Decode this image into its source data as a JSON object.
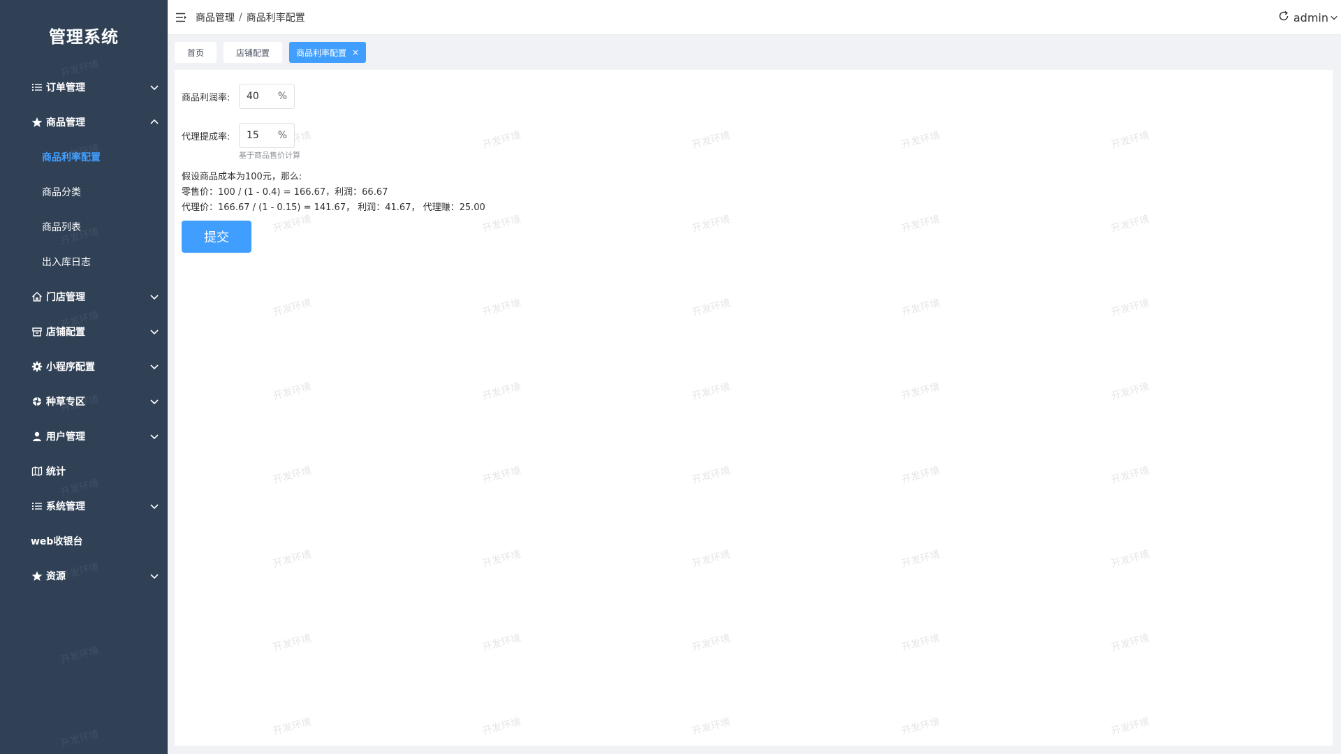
{
  "app": {
    "title": "管理系统"
  },
  "sidebar": {
    "items": [
      {
        "label": "订单管理",
        "icon": "list-icon"
      },
      {
        "label": "商品管理",
        "icon": "star-icon"
      },
      {
        "label": "商品利率配置"
      },
      {
        "label": "商品分类"
      },
      {
        "label": "商品列表"
      },
      {
        "label": "出入库日志"
      },
      {
        "label": "门店管理",
        "icon": "home-icon"
      },
      {
        "label": "店铺配置",
        "icon": "store-icon"
      },
      {
        "label": "小程序配置",
        "icon": "gear-icon"
      },
      {
        "label": "种草专区",
        "icon": "aperture-icon"
      },
      {
        "label": "用户管理",
        "icon": "user-icon"
      },
      {
        "label": "统计",
        "icon": "map-icon"
      },
      {
        "label": "系统管理",
        "icon": "list-icon"
      },
      {
        "label": "web收银台"
      },
      {
        "label": "资源",
        "icon": "star-icon"
      }
    ]
  },
  "header": {
    "breadcrumb": [
      "商品管理",
      "商品利率配置"
    ],
    "breadcrumb_sep": "/",
    "user": "admin"
  },
  "tags": [
    {
      "label": "首页"
    },
    {
      "label": "店铺配置"
    },
    {
      "label": "商品利率配置",
      "close": "×"
    }
  ],
  "form": {
    "profit_label": "商品利润率:",
    "profit_value": "40",
    "profit_suffix": "%",
    "agent_label": "代理提成率:",
    "agent_value": "15",
    "agent_suffix": "%",
    "agent_hint": "基于商品售价计算",
    "calc_intro": "假设商品成本为100元，那么:",
    "calc_retail": "零售价：100 / (1 - 0.4) = 166.67，利润：66.67",
    "calc_agent": "代理价：166.67 / (1 - 0.15) = 141.67， 利润：41.67， 代理赚：25.00",
    "submit_label": "提交"
  },
  "watermark": {
    "text": "开发环境"
  },
  "colors": {
    "sidebar": "#304156",
    "accent": "#409eff"
  }
}
